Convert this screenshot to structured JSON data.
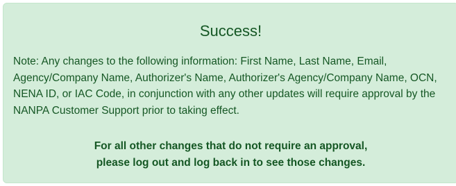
{
  "alert": {
    "title": "Success!",
    "note": "Note: Any changes to the following information: First Name, Last Name, Email, Agency/Company Name, Authorizer's Name, Authorizer's Agency/Company Name, OCN, NENA ID, or IAC Code, in conjunction with any other updates will require approval by the NANPA Customer Support prior to taking effect.",
    "footer_line1": "For all other changes that do not require an approval,",
    "footer_line2": "please log out and log back in to see those changes.",
    "colors": {
      "background": "#d4edda",
      "border": "#c3e6cb",
      "text": "#155724"
    }
  }
}
